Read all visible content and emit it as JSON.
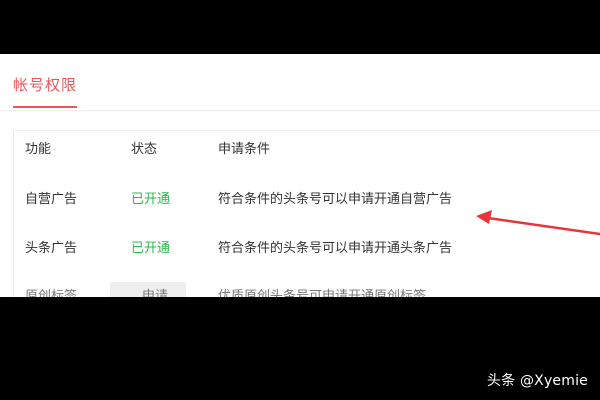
{
  "tabs": {
    "active_label": "帐号权限"
  },
  "table": {
    "headers": {
      "function": "功能",
      "status": "状态",
      "condition": "申请条件"
    },
    "rows": [
      {
        "function": "自营广告",
        "status": "已开通",
        "condition": "符合条件的头条号可以申请开通自营广告"
      },
      {
        "function": "头条广告",
        "status": "已开通",
        "condition": "符合条件的头条号可以申请开通头条广告"
      },
      {
        "function": "原创标签",
        "status": "申请",
        "condition": "优质原创头条号可申请开通原创标签"
      }
    ]
  },
  "colors": {
    "accent": "#e8565a",
    "status_open": "#2db84d",
    "annotation_arrow": "#e8353b"
  },
  "watermark": {
    "text": "头条 @Xyemie"
  }
}
